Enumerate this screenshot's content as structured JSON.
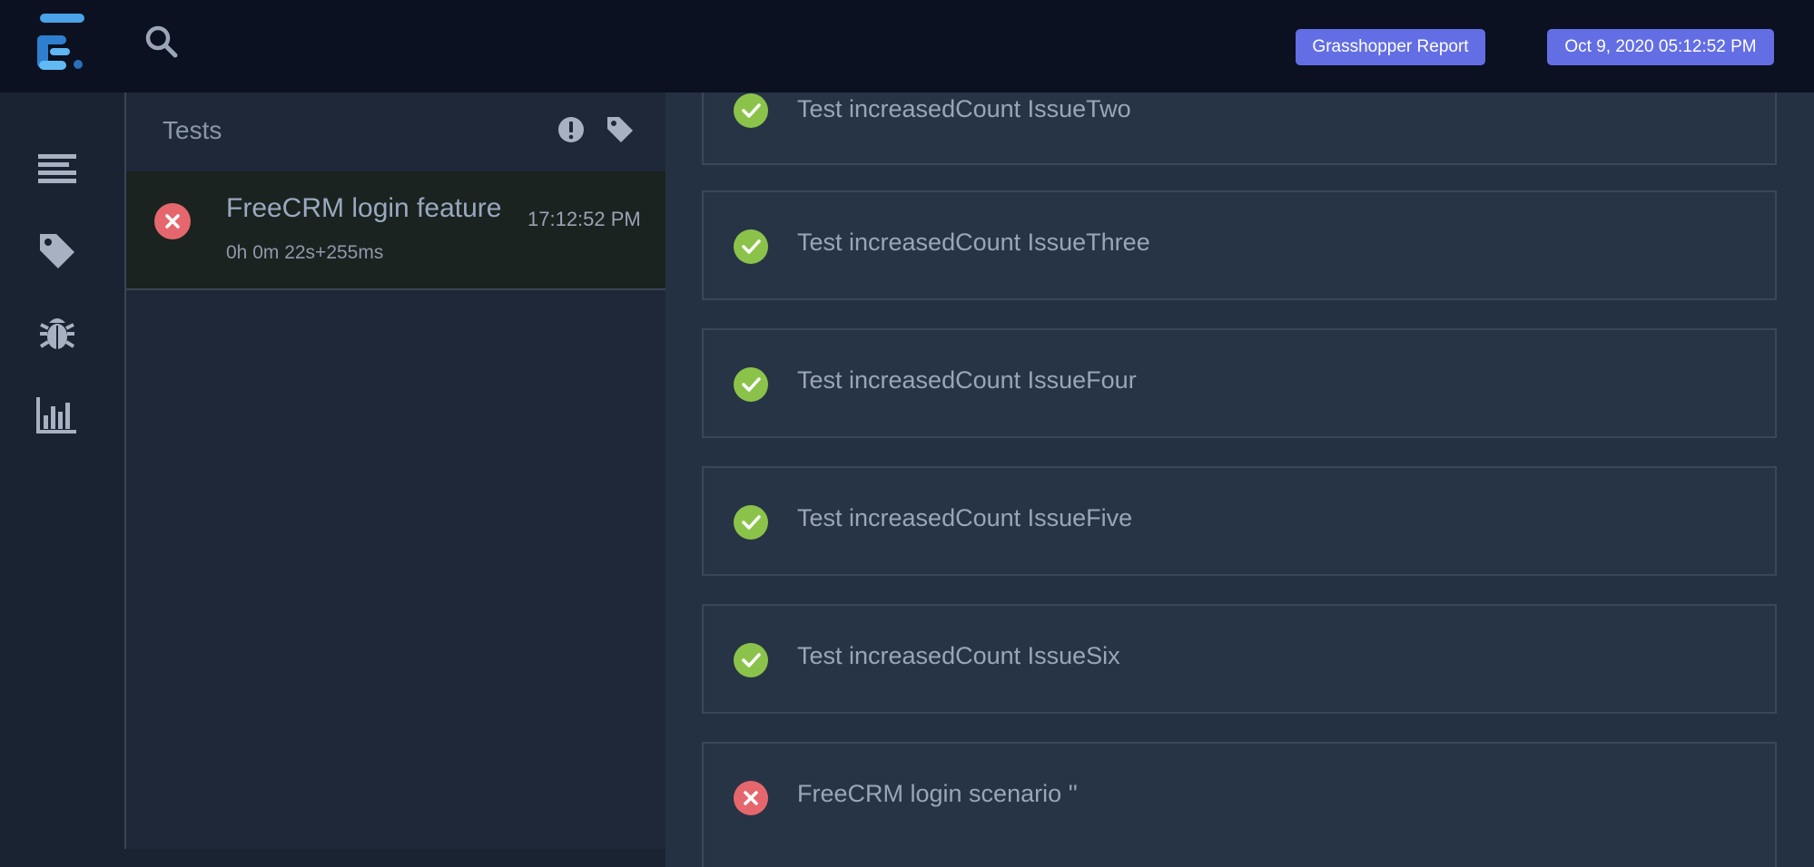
{
  "header": {
    "report_label": "Grasshopper Report",
    "date_label": "Oct 9, 2020 05:12:52 PM"
  },
  "sidebar": {
    "items": [
      {
        "icon": "list-icon"
      },
      {
        "icon": "tag-icon"
      },
      {
        "icon": "bug-icon"
      },
      {
        "icon": "bar-chart-icon"
      }
    ]
  },
  "tests_panel": {
    "title": "Tests",
    "tests": [
      {
        "name": "FreeCRM login feature",
        "duration": "0h 0m 22s+255ms",
        "time": "17:12:52 PM",
        "status": "fail"
      }
    ]
  },
  "content": {
    "nodes": [
      {
        "title": "Test increasedCount IssueTwo",
        "status": "pass"
      },
      {
        "title": "Test increasedCount IssueThree",
        "status": "pass"
      },
      {
        "title": "Test increasedCount IssueFour",
        "status": "pass"
      },
      {
        "title": "Test increasedCount IssueFive",
        "status": "pass"
      },
      {
        "title": "Test increasedCount IssueSix",
        "status": "pass"
      },
      {
        "title": "FreeCRM login scenario ''",
        "status": "fail"
      }
    ]
  },
  "colors": {
    "accent": "#636ee4",
    "pass": "#8bc34a",
    "fail": "#e5676d",
    "topbar": "#0b1120"
  }
}
